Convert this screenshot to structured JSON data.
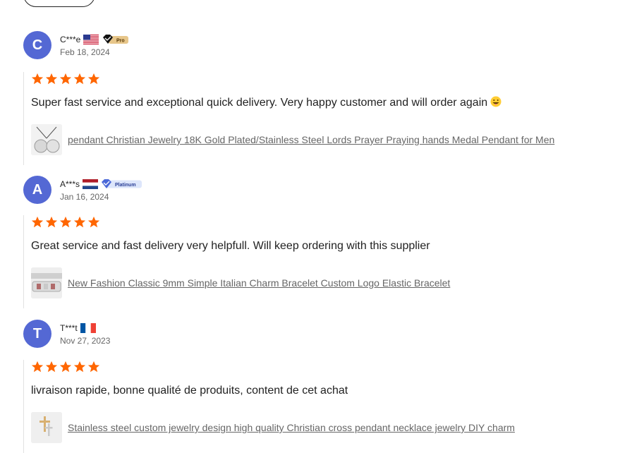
{
  "reviews": [
    {
      "avatar_letter": "C",
      "username": "C***e",
      "country": "United States",
      "badge": "Pro",
      "date": "Feb 18, 2024",
      "rating": 5,
      "text": "Super fast service and exceptional quick delivery. Very happy customer and will order again",
      "emoji": "grinning-face-with-tongue",
      "product": "pendant Christian Jewelry 18K Gold Plated/Stainless Steel Lords Prayer Praying hands Medal Pendant for Men"
    },
    {
      "avatar_letter": "A",
      "username": "A***s",
      "country": "Netherlands",
      "badge": "Platinum",
      "date": "Jan 16, 2024",
      "rating": 5,
      "text": "Great service and fast delivery very helpfull. Will keep ordering with this supplier",
      "product": "New Fashion Classic 9mm Simple Italian Charm Bracelet Custom Logo Elastic Bracelet"
    },
    {
      "avatar_letter": "T",
      "username": "T***t",
      "country": "France",
      "date": "Nov 27, 2023",
      "rating": 5,
      "text": "livraison rapide, bonne qualité de produits, content de cet achat",
      "product": "Stainless steel custom jewelry design high quality Christian cross pendant necklace jewelry DIY charm"
    }
  ],
  "colors": {
    "avatar": "#5468d4",
    "star": "#ff6600",
    "link": "#666666"
  }
}
